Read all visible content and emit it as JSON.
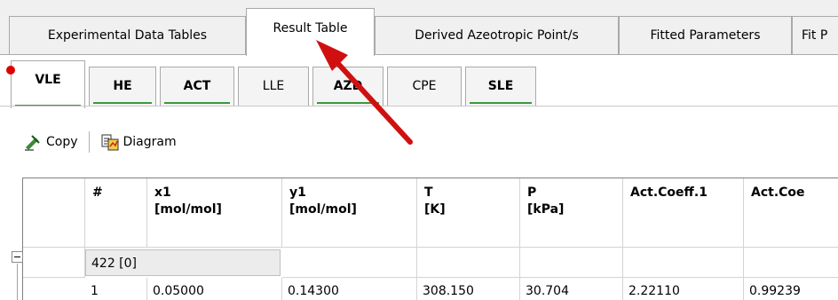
{
  "top_tabs": [
    {
      "label": "Experimental Data Tables"
    },
    {
      "label": "Result Table"
    },
    {
      "label": "Derived Azeotropic Point/s"
    },
    {
      "label": "Fitted Parameters"
    },
    {
      "label": "Fit P"
    }
  ],
  "sub_tabs": [
    {
      "label": "VLE"
    },
    {
      "label": "HE"
    },
    {
      "label": "ACT"
    },
    {
      "label": "LLE"
    },
    {
      "label": "AZD"
    },
    {
      "label": "CPE"
    },
    {
      "label": "SLE"
    }
  ],
  "toolbar": {
    "copy_label": "Copy",
    "diagram_label": "Diagram"
  },
  "table": {
    "headers": [
      {
        "line1": "#",
        "line2": ""
      },
      {
        "line1": "x1",
        "line2": "[mol/mol]"
      },
      {
        "line1": "y1",
        "line2": "[mol/mol]"
      },
      {
        "line1": "T",
        "line2": "[K]"
      },
      {
        "line1": "P",
        "line2": "[kPa]"
      },
      {
        "line1": "Act.Coeff.1",
        "line2": ""
      },
      {
        "line1": "Act.Coe",
        "line2": ""
      }
    ],
    "group_label": "422 [0]",
    "rows": [
      [
        "1",
        "0.05000",
        "0.14300",
        "308.150",
        "30.704",
        "2.22110",
        "0.99239"
      ]
    ]
  },
  "colors": {
    "active_underline": "#3a9a3a",
    "modified_dot": "#e00000",
    "arrow": "#d01010"
  }
}
